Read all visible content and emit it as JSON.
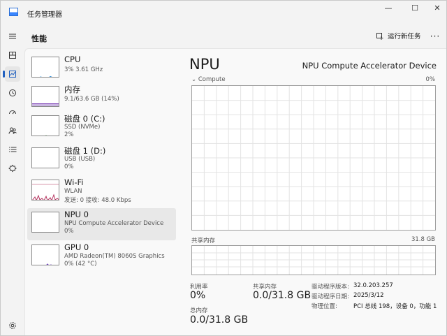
{
  "window": {
    "title": "任务管理器",
    "minimize": "—",
    "maximize": "☐",
    "close": "✕"
  },
  "header": {
    "title": "性能",
    "run_task_label": "运行新任务",
    "more_label": "···"
  },
  "nav": {
    "items": [
      {
        "name": "hamburger-menu-icon"
      },
      {
        "name": "processes-icon"
      },
      {
        "name": "performance-icon",
        "active": true
      },
      {
        "name": "app-history-icon"
      },
      {
        "name": "startup-apps-icon"
      },
      {
        "name": "users-icon"
      },
      {
        "name": "details-icon"
      },
      {
        "name": "services-icon"
      },
      {
        "name": "settings-icon"
      }
    ]
  },
  "devices": [
    {
      "name": "CPU",
      "line1": "3%  3.61 GHz",
      "line2": "",
      "level": 0.03
    },
    {
      "name": "内存",
      "line1": "9.1/63.6 GB (14%)",
      "line2": "",
      "level": 0.14
    },
    {
      "name": "磁盘 0 (C:)",
      "line1": "SSD (NVMe)",
      "line2": "2%",
      "level": 0.02
    },
    {
      "name": "磁盘 1 (D:)",
      "line1": "USB (USB)",
      "line2": "0%",
      "level": 0
    },
    {
      "name": "Wi-Fi",
      "line1": "WLAN",
      "line2": "发送: 0  接收: 48.0 Kbps",
      "level": 0.2
    },
    {
      "name": "NPU 0",
      "line1": "NPU Compute Accelerator Device",
      "line2": "0%",
      "level": 0,
      "selected": true
    },
    {
      "name": "GPU 0",
      "line1": "AMD Radeon(TM) 8060S Graphics",
      "line2": "0%  (42 °C)",
      "level": 0.05
    }
  ],
  "detail": {
    "title": "NPU",
    "device_name": "NPU Compute Accelerator Device",
    "compute_label": "Compute",
    "compute_max": "0%",
    "shared_label": "共享内存",
    "shared_max": "31.8 GB",
    "stats": {
      "util_label": "利用率",
      "util_value": "0%",
      "shared_label": "共享内存",
      "shared_value": "0.0/31.8 GB",
      "total_label": "总内存",
      "total_value": "0.0/31.8 GB"
    },
    "info": {
      "driver_version_label": "驱动程序版本:",
      "driver_version": "32.0.203.257",
      "driver_date_label": "驱动程序日期:",
      "driver_date": "2025/3/12",
      "location_label": "物理位置:",
      "location": "PCI 总线 198，设备 0，功能 1"
    }
  },
  "colors": {
    "accent": "#1f5fbf",
    "cpu": "#2a8ad6",
    "memory": "#7b3fb5",
    "disk": "#3f9b3f",
    "wifi": "#b5335f",
    "gpu": "#6d3fbf"
  }
}
